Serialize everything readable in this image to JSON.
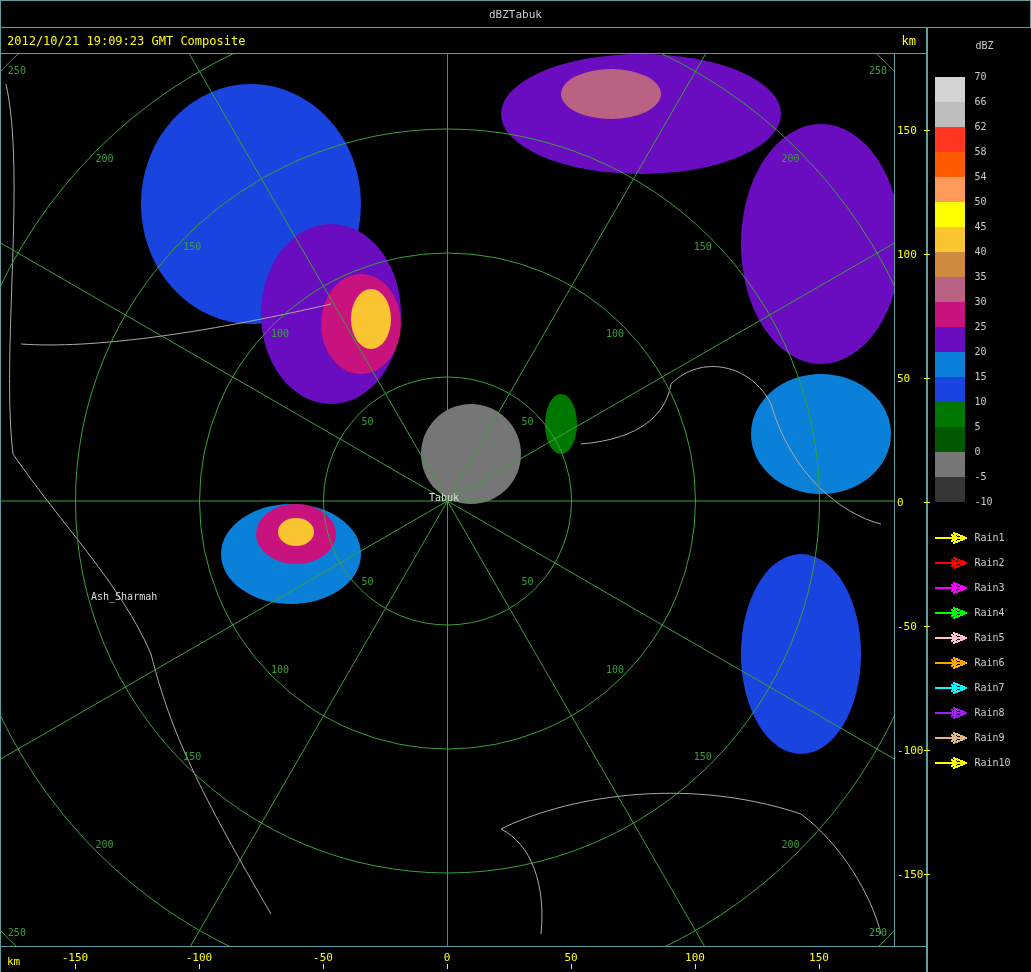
{
  "window": {
    "title": "dBZTabuk"
  },
  "header": {
    "timestamp": "2012/10/21 19:09:23 GMT Composite",
    "unit": "km"
  },
  "plot": {
    "range_rings": [
      {
        "labels": [
          "50",
          "50",
          "50",
          "50"
        ]
      },
      {
        "labels": [
          "100",
          "100",
          "100",
          "100"
        ]
      },
      {
        "labels": [
          "150",
          "150",
          "150",
          "150"
        ]
      },
      {
        "labels": [
          "200",
          "200",
          "200",
          "200"
        ]
      },
      {
        "labels": [
          "250",
          "250",
          "250",
          "250"
        ]
      }
    ],
    "places": [
      {
        "name": "Ash_Sharmah"
      },
      {
        "name": "Tabuk"
      }
    ]
  },
  "x_axis": {
    "unit": "km",
    "ticks": [
      "-150",
      "-100",
      "-50",
      "0",
      "50",
      "100",
      "150"
    ]
  },
  "y_axis": {
    "ticks": [
      "150",
      "100",
      "50",
      "0",
      "-50",
      "-100",
      "-150"
    ]
  },
  "legend": {
    "title": "dBZ",
    "bins": [
      {
        "color": "#d3d3d3"
      },
      {
        "color": "#bebebe"
      },
      {
        "color": "#ff3520"
      },
      {
        "color": "#ff5a00"
      },
      {
        "color": "#ff9a5a"
      },
      {
        "color": "#ffff00"
      },
      {
        "color": "#fbc531"
      },
      {
        "color": "#d08a3f"
      },
      {
        "color": "#ba6283"
      },
      {
        "color": "#c8127e"
      },
      {
        "color": "#6a0dc0"
      },
      {
        "color": "#0a80d8"
      },
      {
        "color": "#1a44e0"
      },
      {
        "color": "#007800"
      },
      {
        "color": "#005800"
      },
      {
        "color": "#767676"
      },
      {
        "color": "#363636"
      }
    ],
    "labels": [
      "70",
      "66",
      "62",
      "58",
      "54",
      "50",
      "45",
      "40",
      "35",
      "30",
      "25",
      "20",
      "15",
      "10",
      "5",
      "0",
      "-5",
      "-10"
    ],
    "tracks": [
      {
        "label": "Rain1",
        "color": "#ffff00"
      },
      {
        "label": "Rain2",
        "color": "#ff0000"
      },
      {
        "label": "Rain3",
        "color": "#ff00ff"
      },
      {
        "label": "Rain4",
        "color": "#00ff00"
      },
      {
        "label": "Rain5",
        "color": "#ffc0cb"
      },
      {
        "label": "Rain6",
        "color": "#ffa500"
      },
      {
        "label": "Rain7",
        "color": "#00ffff"
      },
      {
        "label": "Rain8",
        "color": "#a020f0"
      },
      {
        "label": "Rain9",
        "color": "#deb887"
      },
      {
        "label": "Rain10",
        "color": "#ffff00"
      }
    ]
  }
}
